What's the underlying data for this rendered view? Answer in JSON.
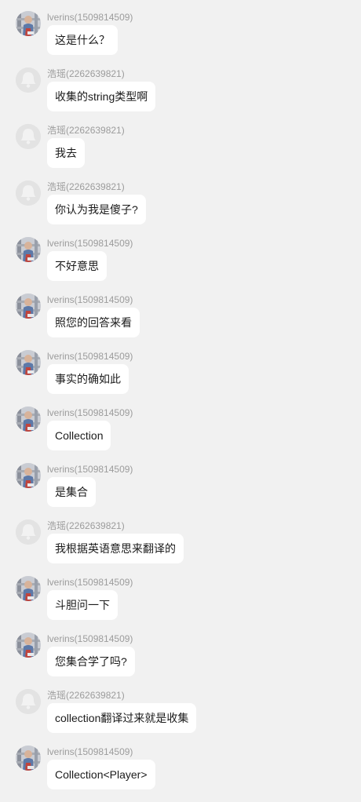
{
  "messages": [
    {
      "sender": "lverins(1509814509)",
      "avatar": "photo",
      "text": "这是什么？"
    },
    {
      "sender": "浩瑶(2262639821)",
      "avatar": "default",
      "text": "收集的string类型啊"
    },
    {
      "sender": "浩瑶(2262639821)",
      "avatar": "default",
      "text": "我去"
    },
    {
      "sender": "浩瑶(2262639821)",
      "avatar": "default",
      "text": "你认为我是傻子?"
    },
    {
      "sender": "lverins(1509814509)",
      "avatar": "photo",
      "text": "不好意思"
    },
    {
      "sender": "lverins(1509814509)",
      "avatar": "photo",
      "text": "照您的回答来看"
    },
    {
      "sender": "lverins(1509814509)",
      "avatar": "photo",
      "text": "事实的确如此"
    },
    {
      "sender": "lverins(1509814509)",
      "avatar": "photo",
      "text": "Collection"
    },
    {
      "sender": "lverins(1509814509)",
      "avatar": "photo",
      "text": "是集合"
    },
    {
      "sender": "浩瑶(2262639821)",
      "avatar": "default",
      "text": "我根据英语意思来翻译的"
    },
    {
      "sender": "lverins(1509814509)",
      "avatar": "photo",
      "text": "斗胆问一下"
    },
    {
      "sender": "lverins(1509814509)",
      "avatar": "photo",
      "text": "您集合学了吗?"
    },
    {
      "sender": "浩瑶(2262639821)",
      "avatar": "default",
      "text": "collection翻译过来就是收集"
    },
    {
      "sender": "lverins(1509814509)",
      "avatar": "photo",
      "text": "Collection<Player>"
    }
  ]
}
